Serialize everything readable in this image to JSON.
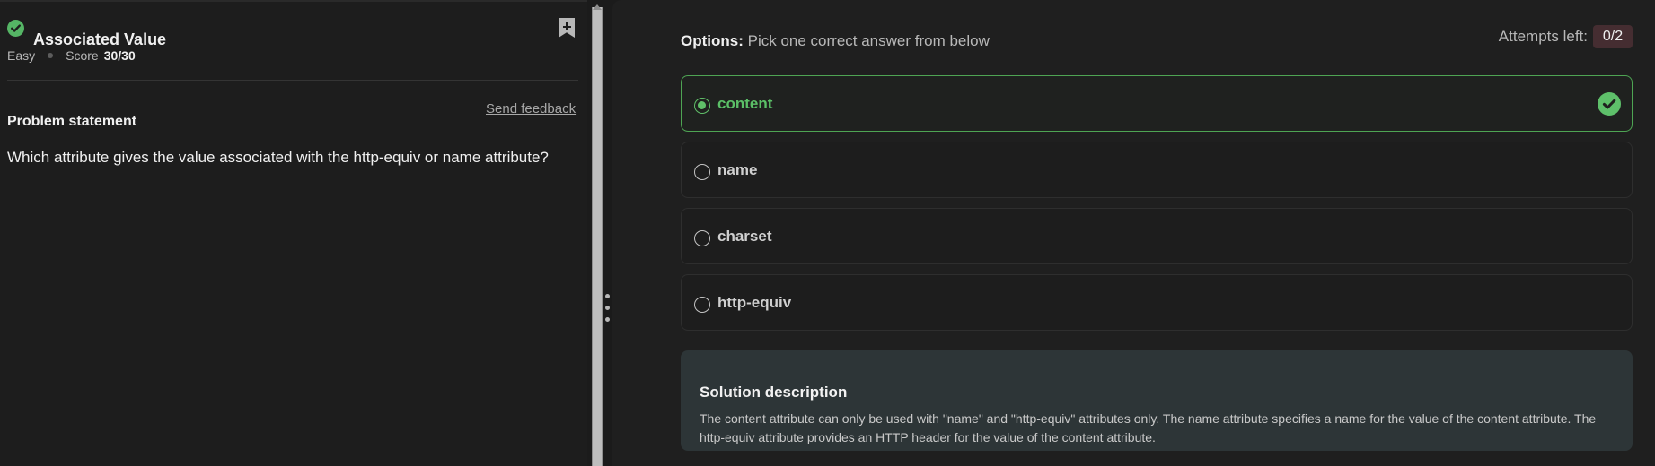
{
  "problem": {
    "title": "Associated Value",
    "difficulty": "Easy",
    "score_label": "Score",
    "score_value": "30/30",
    "statement_heading": "Problem statement",
    "feedback_link": "Send feedback",
    "statement_text": "Which attribute gives the value associated with the http-equiv or name attribute?"
  },
  "quiz": {
    "options_title": "Options:",
    "options_instruction": "Pick one correct answer from below",
    "attempts_label": "Attempts left:",
    "attempts_value": "0/2",
    "options": [
      {
        "label": "content",
        "selected": true,
        "correct": true
      },
      {
        "label": "name",
        "selected": false,
        "correct": false
      },
      {
        "label": "charset",
        "selected": false,
        "correct": false
      },
      {
        "label": "http-equiv",
        "selected": false,
        "correct": false
      }
    ],
    "solution": {
      "title": "Solution description",
      "text": "The content attribute can only be used with \"name\" and \"http-equiv\" attributes only. The name attribute specifies a name for the value of the content attribute. The http-equiv attribute provides an HTTP header for the value of the content attribute."
    }
  },
  "icons": {
    "completed": "check-circle-icon",
    "bookmark": "bookmark-add-icon",
    "correct": "check-circle-icon",
    "resize_handle": "vertical-dots-icon",
    "scroll_up": "up-arrow-icon"
  },
  "colors": {
    "background": "#1b1b1b",
    "panel": "#1f1f1f",
    "accent_green": "#5ec06a",
    "attempts_badge": "#452d31",
    "solution_background": "#2d3537"
  }
}
